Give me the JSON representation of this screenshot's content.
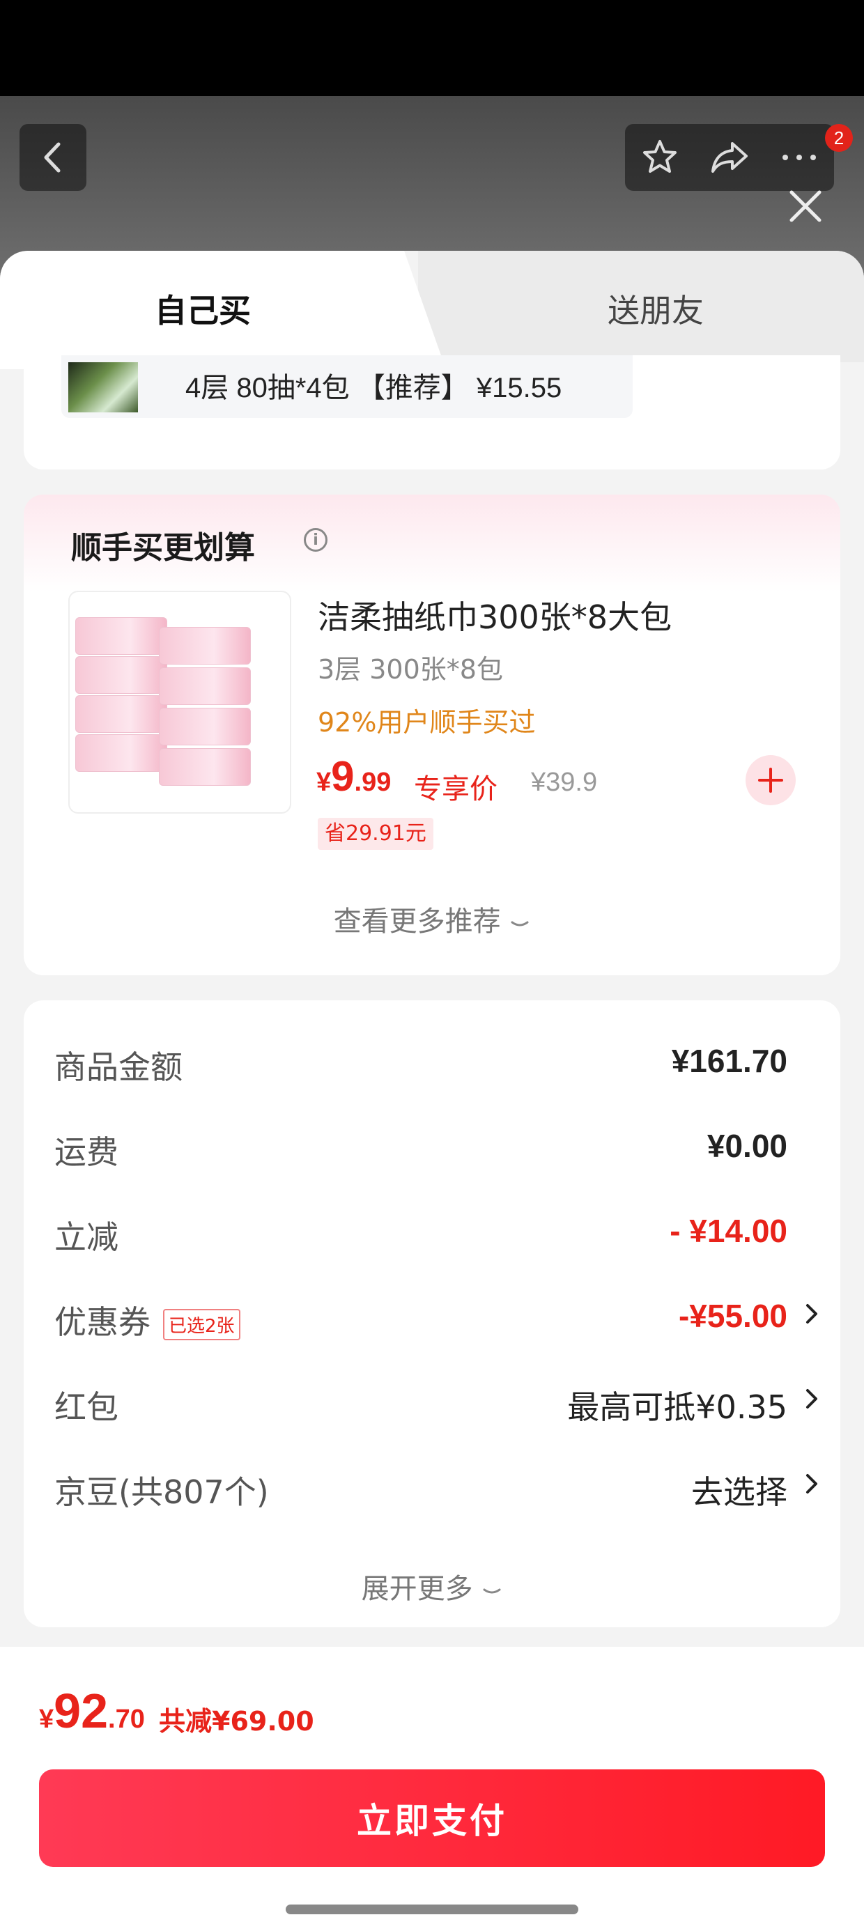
{
  "header": {
    "cart_badge": "2"
  },
  "tabs": {
    "self": "自己买",
    "gift": "送朋友"
  },
  "selected_sku": {
    "text": "4层 80抽*4包 【推荐】  ¥15.55"
  },
  "recommend": {
    "title": "顺手买更划算",
    "product_name": "洁柔抽纸巾300张*8大包",
    "spec": "3层 300张*8包",
    "buyers": "92%用户顺手买过",
    "price_currency": "¥",
    "price_int": "9",
    "price_dec": ".99",
    "exclusive_label": "专享价",
    "original_price": "¥39.9",
    "save_tag": "省29.91元",
    "see_more": "查看更多推荐"
  },
  "summary": {
    "rows": [
      {
        "label": "商品金额",
        "value": "¥161.70"
      },
      {
        "label": "运费",
        "value": "¥0.00"
      },
      {
        "label": "立减",
        "value": "- ¥14.00"
      },
      {
        "label": "优惠券",
        "tag": "已选2张",
        "value": "-¥55.00"
      },
      {
        "label": "红包",
        "value": "最高可抵¥0.35"
      },
      {
        "label": "京豆(共807个)",
        "value": "去选择"
      }
    ],
    "expand_more": "展开更多"
  },
  "footer": {
    "total_currency": "¥",
    "total_int": "92",
    "total_dec": ".70",
    "total_saved": "共减¥69.00",
    "pay_button": "立即支付"
  },
  "colors": {
    "accent_red": "#e8231a",
    "buyers_orange": "#e0861a"
  }
}
